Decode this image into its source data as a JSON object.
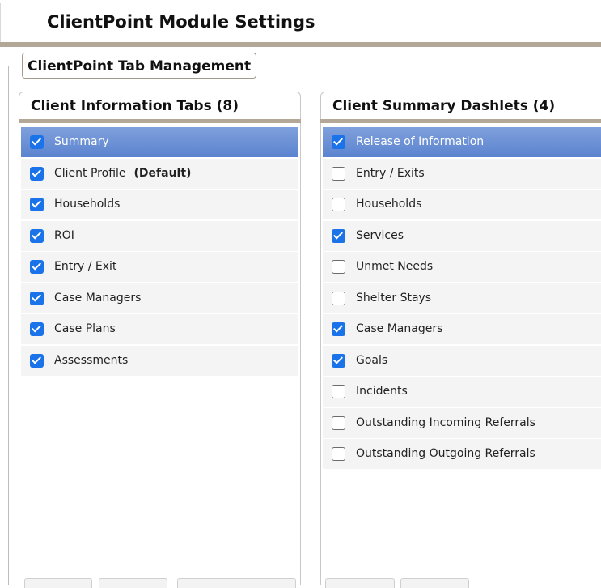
{
  "page": {
    "title": "ClientPoint Module Settings"
  },
  "section": {
    "legend": "ClientPoint Tab Management"
  },
  "client_information_tabs": {
    "title": "Client Information Tabs (8)",
    "items": [
      {
        "label": "Summary",
        "checked": true,
        "selected": true,
        "tag": ""
      },
      {
        "label": "Client Profile",
        "checked": true,
        "selected": false,
        "tag": "(Default)"
      },
      {
        "label": "Households",
        "checked": true,
        "selected": false,
        "tag": ""
      },
      {
        "label": "ROI",
        "checked": true,
        "selected": false,
        "tag": ""
      },
      {
        "label": "Entry / Exit",
        "checked": true,
        "selected": false,
        "tag": ""
      },
      {
        "label": "Case Managers",
        "checked": true,
        "selected": false,
        "tag": ""
      },
      {
        "label": "Case Plans",
        "checked": true,
        "selected": false,
        "tag": ""
      },
      {
        "label": "Assessments",
        "checked": true,
        "selected": false,
        "tag": ""
      }
    ]
  },
  "client_summary_dashlets": {
    "title": "Client Summary Dashlets (4)",
    "items": [
      {
        "label": "Release of Information",
        "checked": true,
        "selected": true
      },
      {
        "label": "Entry / Exits",
        "checked": false,
        "selected": false
      },
      {
        "label": "Households",
        "checked": false,
        "selected": false
      },
      {
        "label": "Services",
        "checked": true,
        "selected": false
      },
      {
        "label": "Unmet Needs",
        "checked": false,
        "selected": false
      },
      {
        "label": "Shelter Stays",
        "checked": false,
        "selected": false
      },
      {
        "label": "Case Managers",
        "checked": true,
        "selected": false
      },
      {
        "label": "Goals",
        "checked": true,
        "selected": false
      },
      {
        "label": "Incidents",
        "checked": false,
        "selected": false
      },
      {
        "label": "Outstanding Incoming Referrals",
        "checked": false,
        "selected": false
      },
      {
        "label": "Outstanding Outgoing Referrals",
        "checked": false,
        "selected": false
      }
    ]
  },
  "colors": {
    "accent_border": "#b3a898",
    "selected_row": "#6a8fd6",
    "checkbox_checked": "#1a73e8",
    "row_background": "#f4f4f4"
  }
}
